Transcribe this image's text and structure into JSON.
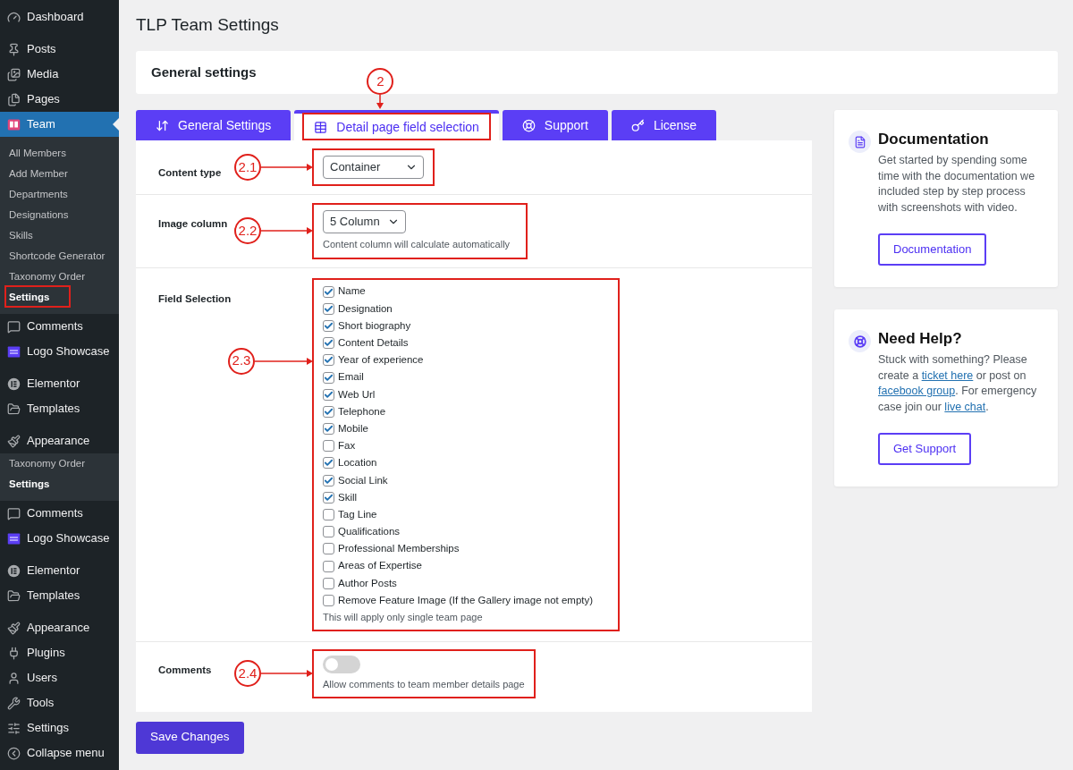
{
  "sidebar": {
    "groups": [
      [
        {
          "label": "Dashboard",
          "selected": false
        }
      ],
      [
        {
          "label": "Posts",
          "selected": false
        },
        {
          "label": "Media",
          "selected": false
        },
        {
          "label": "Pages",
          "selected": false
        },
        {
          "label": "Team",
          "selected": true,
          "children": [
            {
              "label": "All Members",
              "selected": false,
              "highlighted": false
            },
            {
              "label": "Add Member",
              "selected": false,
              "highlighted": false
            },
            {
              "label": "Departments",
              "selected": false,
              "highlighted": false
            },
            {
              "label": "Designations",
              "selected": false,
              "highlighted": false
            },
            {
              "label": "Skills",
              "selected": false,
              "highlighted": false
            },
            {
              "label": "Shortcode Generator",
              "selected": false,
              "highlighted": false
            },
            {
              "label": "Taxonomy Order",
              "selected": false,
              "highlighted": false
            },
            {
              "label": "Settings",
              "selected": true,
              "highlighted": true
            }
          ]
        },
        {
          "label": "Comments",
          "selected": false
        },
        {
          "label": "Logo Showcase",
          "selected": false
        }
      ],
      [
        {
          "label": "Elementor",
          "selected": false
        },
        {
          "label": "Templates",
          "selected": false
        }
      ],
      [
        {
          "label": "Appearance",
          "selected": false,
          "children": [
            {
              "label": "Taxonomy Order",
              "selected": false,
              "highlighted": false
            },
            {
              "label": "Settings",
              "selected": true,
              "highlighted": false
            }
          ]
        },
        {
          "label": "Comments",
          "selected": false
        },
        {
          "label": "Logo Showcase",
          "selected": false
        }
      ],
      [
        {
          "label": "Elementor",
          "selected": false
        },
        {
          "label": "Templates",
          "selected": false
        }
      ],
      [
        {
          "label": "Appearance",
          "selected": false
        },
        {
          "label": "Plugins",
          "selected": false
        },
        {
          "label": "Users",
          "selected": false
        },
        {
          "label": "Tools",
          "selected": false
        },
        {
          "label": "Settings",
          "selected": false
        },
        {
          "label": "Collapse menu",
          "selected": false
        }
      ]
    ]
  },
  "page_title": "TLP Team Settings",
  "header_card": {
    "title": "General settings"
  },
  "tabs": [
    {
      "label": "General Settings",
      "selected": false,
      "highlighted": false
    },
    {
      "label": "Detail page field selection",
      "selected": true,
      "highlighted": true,
      "callout": "2"
    },
    {
      "label": "Support",
      "selected": false,
      "highlighted": false
    },
    {
      "label": "License",
      "selected": false,
      "highlighted": false
    }
  ],
  "rows": [
    {
      "kind": "select",
      "label": "Content type",
      "value": "Container",
      "callout": "2.1"
    },
    {
      "kind": "select",
      "label": "Image column",
      "value": "5 Column",
      "hint": "Content column will calculate automatically",
      "callout": "2.2"
    },
    {
      "kind": "checkboxes",
      "label": "Field Selection",
      "callout": "2.3",
      "hint": "This will apply only single team page",
      "options": [
        {
          "label": "Name",
          "checked": true
        },
        {
          "label": "Designation",
          "checked": true
        },
        {
          "label": "Short biography",
          "checked": true
        },
        {
          "label": "Content Details",
          "checked": true
        },
        {
          "label": "Year of experience",
          "checked": true
        },
        {
          "label": "Email",
          "checked": true
        },
        {
          "label": "Web Url",
          "checked": true
        },
        {
          "label": "Telephone",
          "checked": true
        },
        {
          "label": "Mobile",
          "checked": true
        },
        {
          "label": "Fax",
          "checked": false
        },
        {
          "label": "Location",
          "checked": true
        },
        {
          "label": "Social Link",
          "checked": true
        },
        {
          "label": "Skill",
          "checked": true
        },
        {
          "label": "Tag Line",
          "checked": false
        },
        {
          "label": "Qualifications",
          "checked": false
        },
        {
          "label": "Professional Memberships",
          "checked": false
        },
        {
          "label": "Areas of Expertise",
          "checked": false
        },
        {
          "label": "Author Posts",
          "checked": false
        },
        {
          "label": "Remove Feature Image (If the Gallery image not empty)",
          "checked": false
        }
      ]
    },
    {
      "kind": "toggle",
      "label": "Comments",
      "on": false,
      "hint": "Allow comments to team member details page",
      "callout": "2.4"
    }
  ],
  "save_button": "Save Changes",
  "side_cards": [
    {
      "kind": "documentation",
      "title": "Documentation",
      "parts": [
        {
          "kind": "text",
          "text": "Get started by spending some time with the documentation we included step by step process with screenshots with video."
        }
      ],
      "button": "Documentation"
    },
    {
      "kind": "help",
      "title": "Need Help?",
      "parts": [
        {
          "kind": "text",
          "text": "Stuck with something? Please create a "
        },
        {
          "kind": "link",
          "text": "ticket here"
        },
        {
          "kind": "text",
          "text": " or post on "
        },
        {
          "kind": "link",
          "text": "facebook group"
        },
        {
          "kind": "text",
          "text": ". For emergency case join our "
        },
        {
          "kind": "link",
          "text": "live chat"
        },
        {
          "kind": "text",
          "text": "."
        }
      ],
      "button": "Get Support"
    }
  ]
}
